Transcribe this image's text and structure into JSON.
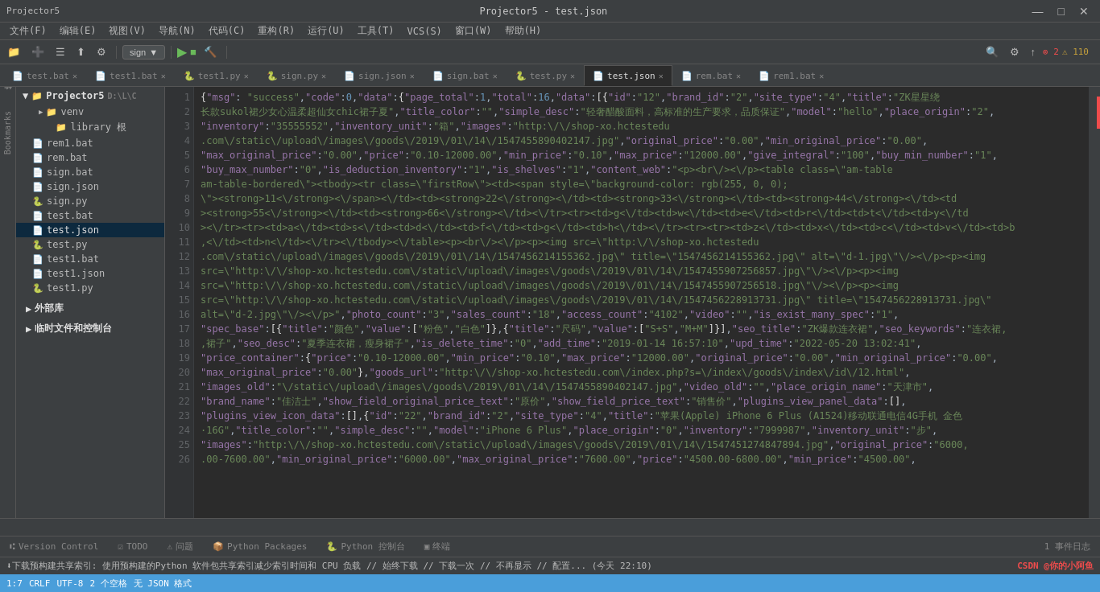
{
  "titlebar": {
    "app": "Projector5",
    "file": "test.json",
    "title": "Projector5 - test.json",
    "controls": [
      "—",
      "□",
      "✕"
    ]
  },
  "menubar": {
    "items": [
      "文件(F)",
      "编辑(E)",
      "视图(V)",
      "导航(N)",
      "代码(C)",
      "重构(R)",
      "运行(U)",
      "工具(T)",
      "VCS(S)",
      "窗口(W)",
      "帮助(H)"
    ]
  },
  "toolbar": {
    "project": "Projector5",
    "sign_label": "sign",
    "run_icon": "▶",
    "debug_icon": "🐛",
    "build_icon": "🔨",
    "search_icon": "🔍",
    "settings_icon": "⚙",
    "git_icon": "↑",
    "counter": "2",
    "counter2": "110"
  },
  "tabs": [
    {
      "label": "test.bat",
      "icon": "📄",
      "active": false,
      "modified": false
    },
    {
      "label": "test1.bat",
      "icon": "📄",
      "active": false,
      "modified": false
    },
    {
      "label": "test1.py",
      "icon": "🐍",
      "active": false,
      "modified": false
    },
    {
      "label": "sign.py",
      "icon": "🐍",
      "active": false,
      "modified": false
    },
    {
      "label": "sign.json",
      "icon": "📄",
      "active": false,
      "modified": false
    },
    {
      "label": "sign.bat",
      "icon": "📄",
      "active": false,
      "modified": false
    },
    {
      "label": "test.py",
      "icon": "🐍",
      "active": false,
      "modified": false
    },
    {
      "label": "test.json",
      "icon": "📄",
      "active": true,
      "modified": false
    },
    {
      "label": "rem.bat",
      "icon": "📄",
      "active": false,
      "modified": false
    },
    {
      "label": "rem1.bat",
      "icon": "📄",
      "active": false,
      "modified": false
    }
  ],
  "sidebar": {
    "project_name": "Projector5",
    "project_path": "D:\\L\\C",
    "items": [
      {
        "label": "venv",
        "type": "folder",
        "indent": 1,
        "expanded": false
      },
      {
        "label": "library 根",
        "type": "folder",
        "indent": 2,
        "expanded": false
      },
      {
        "label": "rem1.bat",
        "type": "file",
        "indent": 1
      },
      {
        "label": "rem.bat",
        "type": "file",
        "indent": 1
      },
      {
        "label": "sign.bat",
        "type": "file",
        "indent": 1
      },
      {
        "label": "sign.json",
        "type": "file",
        "indent": 1
      },
      {
        "label": "sign.py",
        "type": "file",
        "indent": 1
      },
      {
        "label": "test.bat",
        "type": "file",
        "indent": 1
      },
      {
        "label": "test.json",
        "type": "file",
        "indent": 1,
        "active": true
      },
      {
        "label": "test.py",
        "type": "file",
        "indent": 1
      },
      {
        "label": "test1.bat",
        "type": "file",
        "indent": 1
      },
      {
        "label": "test1.json",
        "type": "file",
        "indent": 1
      },
      {
        "label": "test1.py",
        "type": "file",
        "indent": 1
      }
    ],
    "external_lib": "外部库",
    "scratch": "临时文件和控制台"
  },
  "code": {
    "lines": [
      "{\"msg\": \"success\",\"code\":0,\"data\":{\"page_total\":1,\"total\":16,\"data\":[{\"id\":\"12\",\"brand_id\":\"2\",\"site_type\":\"4\",\"title\":\"ZK星星绕  ↵",
      "长款sukol裙少女心温柔超仙女chic裙子夏\",\"title_color\":\"\",\"simple_desc\":\"轻奢醋酸面料，高标准的生产要求，品质保证\",\"model\":\"hello\",\"place_origin\":\"2\", ↵",
      "\"inventory\":\"35555552\",\"inventory_unit\":\"箱\",\"images\":\"http:\\/\\/shop-xo.hctestedu ↵",
      ".com\\/static\\/upload\\/images\\/goods\\/2019\\/01\\/14\\/1547455890402147.jpg\",\"original_price\":\"0.00\",\"min_original_price\":\"0.00\", ↵",
      "\"max_original_price\":\"0.00\",\"price\":\"0.10-12000.00\",\"min_price\":\"0.10\",\"max_price\":\"12000.00\",\"give_integral\":\"100\",\"buy_min_number\":\"1\", ↵",
      "\"buy_max_number\":\"0\",\"is_deduction_inventory\":\"1\",\"is_shelves\":\"1\",\"content_web\":\"<p><br\\/><\\/p><table class=\\\"am-table ↵",
      "am-table-bordered\\\"><tbody><tr class=\\\"firstRow\\\"><td><span style=\\\"background-color: rgb(255, 0, 0); ↵",
      "\\\"><strong>11<\\/strong><\\/span><\\/td><td><strong>22<\\/strong><\\/td><td><strong>33<\\/strong><\\/td><td><strong>44<\\/strong><\\/td><td ↵",
      "><strong>55<\\/strong><\\/td><td><strong>66<\\/strong><\\/td><\\/tr><tr><td>g<\\/td><td>w<\\/td><td>e<\\/td><td>r<\\/td><td>t<\\/td><td>y<\\/td ↵",
      "><\\/tr><tr><td>a<\\/td><td>s<\\/td><td>d<\\/td><td>f<\\/td><td>g<\\/td><td>h<\\/td><\\/tr><tr><tr><td>z<\\/td><td>x<\\/td><td>c<\\/td><td>v<\\/td><td>b ↵",
      ",<\\/td><td>n<\\/td><\\/tr><\\/tbody><\\/table><p><br\\/><\\/p><p><img src=\\\"http:\\/\\/shop-xo.hctestedu ↵",
      ".com\\/static\\/upload\\/images\\/goods\\/2019\\/01\\/14\\/1547456214155362.jpg\\\" title=\\\"1547456214155362.jpg\\\" alt=\\\"d-1.jpg\\\"\\/><\\/p><p><img ↵",
      "src=\\\"http:\\/\\/shop-xo.hctestedu.com\\/static\\/upload\\/images\\/goods\\/2019\\/01\\/14\\/1547455907256857.jpg\\\"\\/><\\/p><p><img ↵",
      "src=\\\"http:\\/\\/shop-xo.hctestedu.com\\/static\\/upload\\/images\\/goods\\/2019\\/01\\/14\\/1547455907256518.jpg\\\"\\/><\\/p><p><img ↵",
      "src=\\\"http:\\/\\/shop-xo.hctestedu.com\\/static\\/upload\\/images\\/goods\\/2019\\/01\\/14\\/1547456228913731.jpg\\\" title=\\\"1547456228913731.jpg\\\" ↵",
      "alt=\\\"d-2.jpg\\\"\\/><\\/p>\",\"photo_count\":\"3\",\"sales_count\":\"18\",\"access_count\":\"4102\",\"video\":\"\",\"is_exist_many_spec\":\"1\", ↵",
      "\"spec_base\":[{\"title\":\"颜色\",\"value\":[\"粉色\",\"白色\"]},{\"title\":\"尺码\",\"value\":[\"S+S\",\"M+M\"]}],\"seo_title\":\"ZK爆款连衣裙\",\"seo_keywords\":\"连衣裙, ↵",
      ",裙子\",\"seo_desc\":\"夏季连衣裙，瘦身裙子\",\"is_delete_time\":\"0\",\"add_time\":\"2019-01-14 16:57:10\",\"upd_time\":\"2022-05-20 13:02:41\", ↵",
      "\"price_container\":{\"price\":\"0.10-12000.00\",\"min_price\":\"0.10\",\"max_price\":\"12000.00\",\"original_price\":\"0.00\",\"min_original_price\":\"0.00\", ↵",
      "\"max_original_price\":\"0.00\"},\"goods_url\":\"http:\\/\\/shop-xo.hctestedu.com\\/index.php?s=\\/index\\/goods\\/index\\/id\\/12.html\", ↵",
      "\"images_old\":\"\\/static\\/upload\\/images\\/goods\\/2019\\/01\\/14\\/1547455890402147.jpg\",\"video_old\":\"\",\"place_origin_name\":\"天津市\", ↵",
      "\"brand_name\":\"佳洁士\",\"show_field_original_price_text\":\"原价\",\"show_field_price_text\":\"销售价\",\"plugins_view_panel_data\":[], ↵",
      "\"plugins_view_icon_data\":[]},{\"id\":\"22\",\"brand_id\":\"2\",\"site_type\":\"4\",\"title\":\"苹果(Apple) iPhone 6 Plus (A1524)移动联通电信4G手机 金色  ↵",
      "·16G\",\"title_color\":\"\",\"simple_desc\":\"\",\"model\":\"iPhone 6 Plus\",\"place_origin\":\"0\",\"inventory\":\"7999987\",\"inventory_unit\":\"步\", ↵",
      "\"images\":\"http:\\/\\/shop-xo.hctestedu.com\\/static\\/upload\\/images\\/goods\\/2019\\/01\\/14\\/1547451274847894.jpg\",\"original_price\":\"6000, ↵",
      ".00-7600.00\",\"min_original_price\":\"6000.00\",\"max_original_price\":\"7600.00\",\"price\":\"4500.00-6800.00\",\"min_price\":\"4500.00\", ↵"
    ]
  },
  "bottom_tabs": [
    {
      "label": "Version Control",
      "icon": "⑆",
      "active": false
    },
    {
      "label": "TODO",
      "icon": "☑",
      "active": false
    },
    {
      "label": "问题",
      "icon": "⚠",
      "active": false
    },
    {
      "label": "Python Packages",
      "icon": "📦",
      "active": false
    },
    {
      "label": "Python 控制台",
      "icon": "🐍",
      "active": false
    },
    {
      "label": "终端",
      "icon": "▣",
      "active": false
    }
  ],
  "statusbar": {
    "notification": "下载预构建共享索引: 使用预构建的Python 软件包共享索引减少索引时间和 CPU 负载 // 始终下载 // 下载一次 // 不再显示 // 配置... (今天 22:10)",
    "position": "1:7",
    "encoding": "CRLF",
    "charset": "UTF-8",
    "indent": "2 个空格",
    "format": "无 JSON 格式",
    "event": "1 事件日志",
    "watermark": "CSDN @你的小阿鱼"
  },
  "error_count": "2",
  "warning_count": "110",
  "msg_label": "msg"
}
